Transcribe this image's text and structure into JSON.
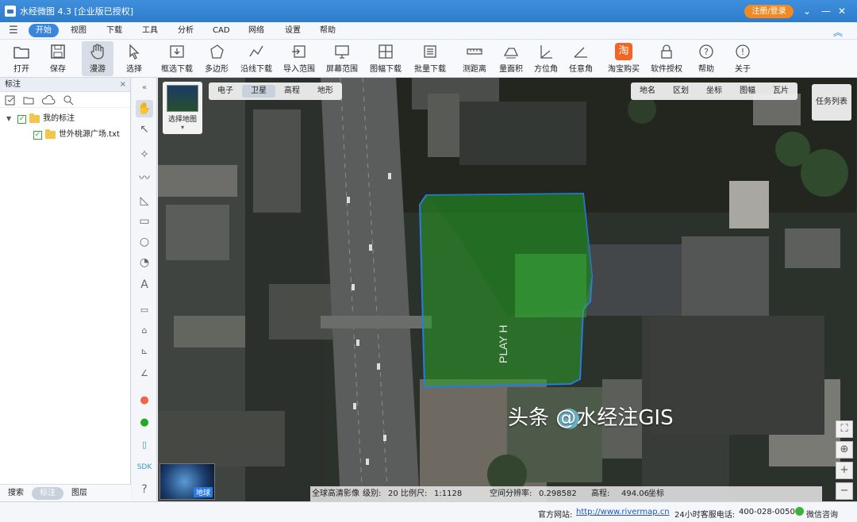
{
  "window": {
    "title": "水经微图 4.3 [企业版已授权]",
    "login_label": "注册/登录"
  },
  "menu": [
    "开始",
    "视图",
    "下载",
    "工具",
    "分析",
    "CAD",
    "网络",
    "设置",
    "帮助"
  ],
  "toolbar": [
    "打开",
    "保存",
    "漫游",
    "选择",
    "框选下载",
    "多边形",
    "沿线下载",
    "导入范围",
    "屏幕范围",
    "图幅下载",
    "批量下载",
    "测距离",
    "量面积",
    "方位角",
    "任意角",
    "淘宝购买",
    "软件授权",
    "帮助",
    "关于"
  ],
  "left_panel": {
    "title": "标注",
    "tree": {
      "root": "我的标注",
      "child": "世外桃源广场.txt"
    },
    "tabs": [
      "搜索",
      "标注",
      "图层"
    ]
  },
  "map": {
    "layer_tabs": [
      "电子",
      "卫星",
      "高程",
      "地形"
    ],
    "overlay_tabs": [
      "地名",
      "区划",
      "坐标",
      "图幅",
      "瓦片"
    ],
    "select_map_label": "选择地图",
    "task_list_label": "任务列表",
    "globe_label": "地球",
    "polygon_color": "#2aa02a",
    "info": {
      "imagery": "全球高清影像",
      "level_label": "级别:",
      "level_value": "20",
      "scale_label": "比例尺:",
      "scale_value": "1:1128",
      "resolution_label": "空间分辨率:",
      "resolution_value": "0.298582",
      "elevation_label": "高程:",
      "elevation_value": "494.06",
      "coord_label": "坐标"
    },
    "watermark": "头条 @水经注GIS"
  },
  "status": {
    "website_label": "官方网站:",
    "website_url": "http://www.rivermap.cn",
    "hotline_label": "24小时客服电话:",
    "hotline_value": "400-028-0050",
    "wechat_label": "微信咨询"
  }
}
